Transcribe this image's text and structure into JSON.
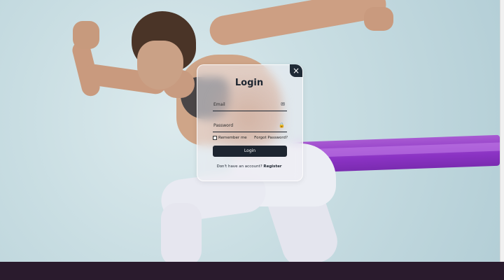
{
  "login": {
    "title": "Login",
    "close_icon": "×",
    "email_label": "Email",
    "email_icon": "✉",
    "password_label": "Password",
    "password_icon": "🔒",
    "remember_label": "Remember me",
    "forgot_label": "Forgot Password?",
    "submit_label": "Login",
    "register_prompt": "Don't have an account?",
    "register_link": "Register"
  },
  "colors": {
    "accent_dark": "#1d2530",
    "band_purple": "#8b33c4",
    "footer": "#2a1b2d"
  }
}
